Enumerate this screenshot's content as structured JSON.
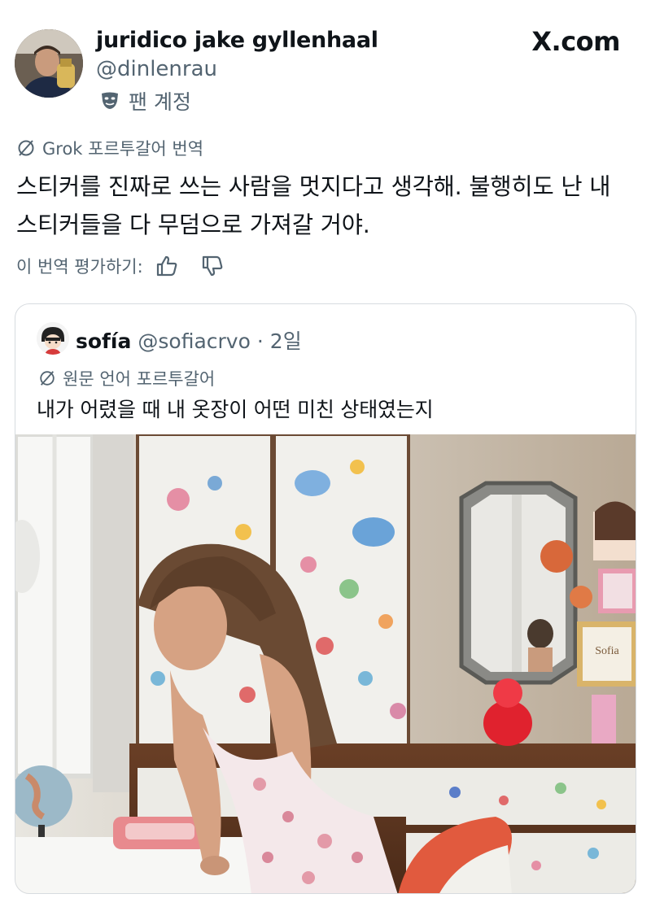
{
  "author": {
    "name": "juridico jake gyllenhaal",
    "handle": "@dinlenrau",
    "badge_label": "팬 계정"
  },
  "brand": "X.com",
  "translation": {
    "source_label": "Grok 포르투갈어 번역",
    "text": "스티커를 진짜로 쓰는 사람을 멋지다고 생각해. 불행히도 난 내 스티커들을 다 무덤으로 가져갈 거야.",
    "rate_label": "이 번역 평가하기:"
  },
  "quoted": {
    "name": "sofía",
    "handle": "@sofiacrvo",
    "time": "· 2일",
    "language_label": "원문 언어 포르투갈어",
    "text": "내가 어렸을 때 내 옷장이 어떤 미친 상태였는지"
  },
  "icons": {
    "globe": "translate-icon",
    "mask": "theater-mask-icon",
    "thumbs_up": "thumbs-up-icon",
    "thumbs_down": "thumbs-down-icon"
  },
  "photo": {
    "mirror_sign": "Sofia"
  }
}
